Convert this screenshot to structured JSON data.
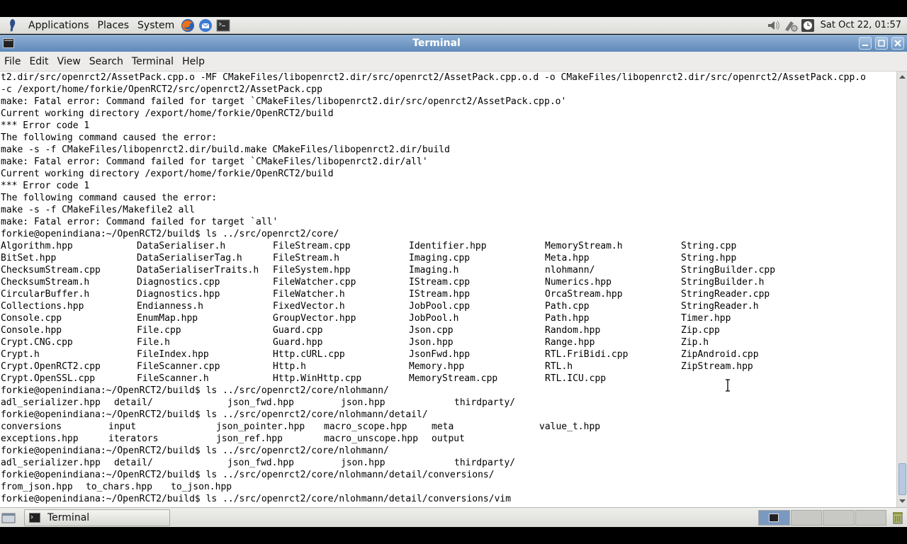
{
  "top_panel": {
    "menus": [
      "Applications",
      "Places",
      "System"
    ],
    "clock": "Sat Oct 22, 01:57"
  },
  "window": {
    "title": "Terminal"
  },
  "menubar": [
    "File",
    "Edit",
    "View",
    "Search",
    "Terminal",
    "Help"
  ],
  "terminal": {
    "lines_top": [
      "t2.dir/src/openrct2/AssetPack.cpp.o -MF CMakeFiles/libopenrct2.dir/src/openrct2/AssetPack.cpp.o.d -o CMakeFiles/libopenrct2.dir/src/openrct2/AssetPack.cpp.o",
      "-c /export/home/forkie/OpenRCT2/src/openrct2/AssetPack.cpp",
      "make: Fatal error: Command failed for target `CMakeFiles/libopenrct2.dir/src/openrct2/AssetPack.cpp.o'",
      "Current working directory /export/home/forkie/OpenRCT2/build",
      "*** Error code 1",
      "The following command caused the error:",
      "make -s -f CMakeFiles/libopenrct2.dir/build.make CMakeFiles/libopenrct2.dir/build",
      "make: Fatal error: Command failed for target `CMakeFiles/libopenrct2.dir/all'",
      "Current working directory /export/home/forkie/OpenRCT2/build",
      "*** Error code 1",
      "The following command caused the error:",
      "make -s -f CMakeFiles/Makefile2 all",
      "make: Fatal error: Command failed for target `all'",
      "forkie@openindiana:~/OpenRCT2/build$ ls ../src/openrct2/core/"
    ],
    "core_listing": [
      [
        "Algorithm.hpp",
        "DataSerialiser.h",
        "FileStream.cpp",
        "Identifier.hpp",
        "MemoryStream.h",
        "String.cpp"
      ],
      [
        "BitSet.hpp",
        "DataSerialiserTag.h",
        "FileStream.h",
        "Imaging.cpp",
        "Meta.hpp",
        "String.hpp"
      ],
      [
        "ChecksumStream.cpp",
        "DataSerialiserTraits.h",
        "FileSystem.hpp",
        "Imaging.h",
        "nlohmann/",
        "StringBuilder.cpp"
      ],
      [
        "ChecksumStream.h",
        "Diagnostics.cpp",
        "FileWatcher.cpp",
        "IStream.cpp",
        "Numerics.hpp",
        "StringBuilder.h"
      ],
      [
        "CircularBuffer.h",
        "Diagnostics.hpp",
        "FileWatcher.h",
        "IStream.hpp",
        "OrcaStream.hpp",
        "StringReader.cpp"
      ],
      [
        "Collections.hpp",
        "Endianness.h",
        "FixedVector.h",
        "JobPool.cpp",
        "Path.cpp",
        "StringReader.h"
      ],
      [
        "Console.cpp",
        "EnumMap.hpp",
        "GroupVector.hpp",
        "JobPool.h",
        "Path.hpp",
        "Timer.hpp"
      ],
      [
        "Console.hpp",
        "File.cpp",
        "Guard.cpp",
        "Json.cpp",
        "Random.hpp",
        "Zip.cpp"
      ],
      [
        "Crypt.CNG.cpp",
        "File.h",
        "Guard.hpp",
        "Json.hpp",
        "Range.hpp",
        "Zip.h"
      ],
      [
        "Crypt.h",
        "FileIndex.hpp",
        "Http.cURL.cpp",
        "JsonFwd.hpp",
        "RTL.FriBidi.cpp",
        "ZipAndroid.cpp"
      ],
      [
        "Crypt.OpenRCT2.cpp",
        "FileScanner.cpp",
        "Http.h",
        "Memory.hpp",
        "RTL.h",
        "ZipStream.hpp"
      ],
      [
        "Crypt.OpenSSL.cpp",
        "FileScanner.h",
        "Http.WinHttp.cpp",
        "MemoryStream.cpp",
        "RTL.ICU.cpp",
        ""
      ]
    ],
    "prompt_1": "forkie@openindiana:~/OpenRCT2/build$ ls ../src/openrct2/core/nlohmann/",
    "nlohmann_listing_1": [
      "adl_serializer.hpp",
      "detail/",
      "json_fwd.hpp",
      "json.hpp",
      "thirdparty/"
    ],
    "prompt_2": "forkie@openindiana:~/OpenRCT2/build$ ls ../src/openrct2/core/nlohmann/detail/",
    "detail_listing": [
      [
        "conversions",
        "input",
        "json_pointer.hpp",
        "macro_scope.hpp",
        "meta",
        "value_t.hpp"
      ],
      [
        "exceptions.hpp",
        "iterators",
        "json_ref.hpp",
        "macro_unscope.hpp",
        "output",
        ""
      ]
    ],
    "prompt_3": "forkie@openindiana:~/OpenRCT2/build$ ls ../src/openrct2/core/nlohmann/",
    "nlohmann_listing_2": [
      "adl_serializer.hpp",
      "detail/",
      "json_fwd.hpp",
      "json.hpp",
      "thirdparty/"
    ],
    "prompt_4": "forkie@openindiana:~/OpenRCT2/build$ ls ../src/openrct2/core/nlohmann/detail/conversions/",
    "conversions_listing": [
      "from_json.hpp",
      "to_chars.hpp",
      "to_json.hpp"
    ],
    "prompt_5": "forkie@openindiana:~/OpenRCT2/build$ ls ../src/openrct2/core/nlohmann/detail/conversions/vim"
  },
  "taskbar": {
    "task_label": "Terminal"
  },
  "colors": {
    "titlebar": "#6f97c6",
    "terminal_bg": "#ffffff",
    "panel_bg": "#e6e6e3"
  }
}
